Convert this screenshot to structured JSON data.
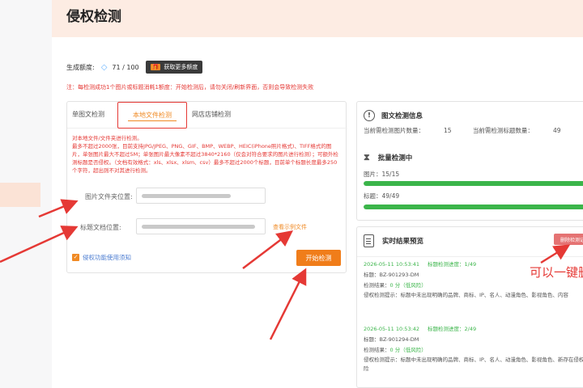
{
  "page": {
    "title": "侵权检测"
  },
  "quota": {
    "label": "生成额度:",
    "value": "71 / 100",
    "more_button": "获取更多额度",
    "gift_glyph": "🎁"
  },
  "notice": "注：每检测成功1个图片或标题消耗1额度：开始检测后，请勿关闭/刷新界面，否则会导致检测失败",
  "tabs": [
    {
      "label": "单图文检测"
    },
    {
      "label": "本地文件检测"
    },
    {
      "label": "网店店铺检测"
    }
  ],
  "rules": [
    "对本地文件/文件夹进行检测。",
    "最多不超过2000张，目前支持JPG/JPEG、PNG、GIF、BMP、WEBP、HEIC(iPhone照片格式)、TIFF格式的图片，单张图片最大不超过5M；单张图片最大像素不超过3840*2160（仅会对符合要求的图片进行检测）；可额外检测标题是否侵权。（文档有效格式：xls、xlsx、xlsm、csv）最多不超过2000个标题，目前单个标题长度最多250个字符，超出则不对其进行检测。"
  ],
  "fields": {
    "image_folder_label": "图片文件夹位置:",
    "title_doc_label": "标题文档位置:",
    "sample_link": "查看示例文件"
  },
  "guide_link": "侵权功能使用须知",
  "start_button": "开始检测",
  "info": {
    "title": "图文检测信息",
    "image_count_label": "当前需检测图片数量：",
    "image_count": "15",
    "title_count_label": "当前需检测标题数量：",
    "title_count": "49"
  },
  "batch": {
    "title": "批量检测中",
    "images_label": "图片：",
    "images_progress": "15/15",
    "images_fraction": 1.0,
    "titles_label": "标题：",
    "titles_progress": "49/49",
    "titles_fraction": 1.0
  },
  "results": {
    "title": "实时结果预览",
    "delete_button": "删除检测记录",
    "entries": [
      {
        "timestamp": "2026-05-11 10:53:41",
        "progress": "标题检测进度：1/49",
        "title_line": "标题：BZ-901293-DM",
        "result_label": "检测结果：",
        "score": "0 分（低风险）",
        "hint": "侵权检测提示：标题中未出现明确的品牌、商标、IP、名人、动漫角色、影视角色、内容"
      },
      {
        "timestamp": "2026-05-11 10:53:42",
        "progress": "标题检测进度：2/49",
        "title_line": "标题：BZ-901294-DM",
        "result_label": "检测结果：",
        "score": "0 分（低风险）",
        "hint": "侵权检测提示：标题中未出现明确的品牌、商标、IP、名人、动漫角色、影视角色、新存在侵权风险"
      }
    ]
  },
  "annotation": "可以一键删",
  "colors": {
    "accent": "#f07d1a",
    "warning": "#e53935",
    "success": "#3bb54a",
    "header_band": "#fdece3"
  }
}
